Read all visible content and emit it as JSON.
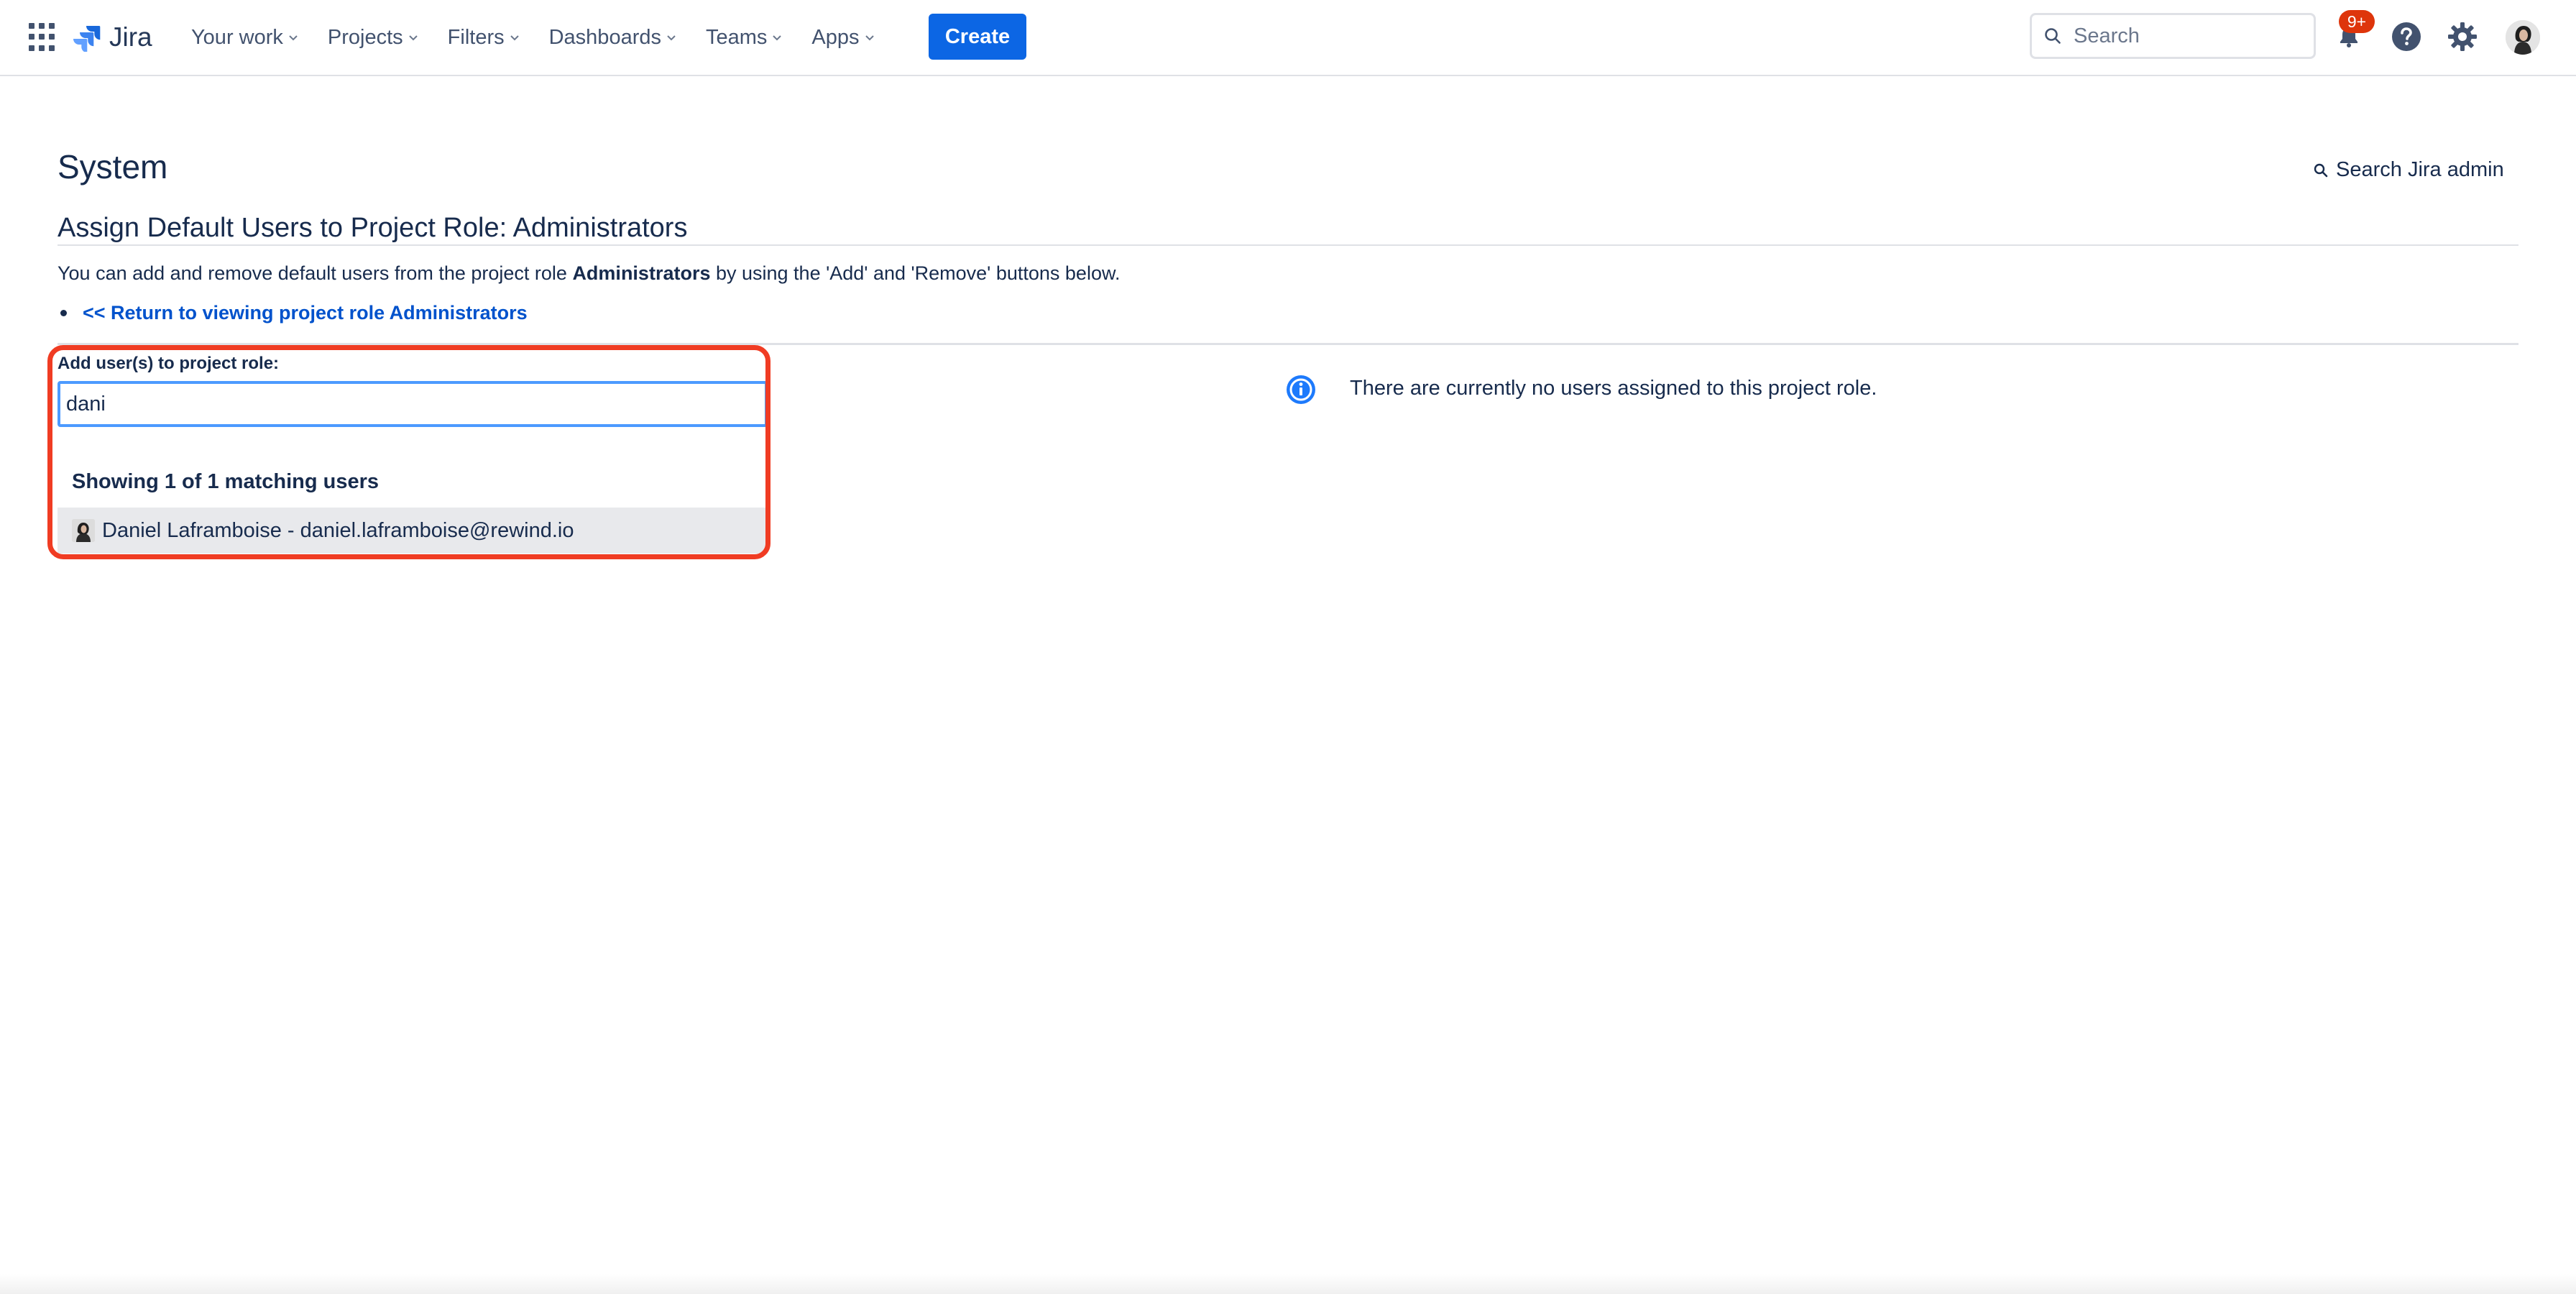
{
  "nav": {
    "logo_text": "Jira",
    "items": [
      {
        "label": "Your work"
      },
      {
        "label": "Projects"
      },
      {
        "label": "Filters"
      },
      {
        "label": "Dashboards"
      },
      {
        "label": "Teams"
      },
      {
        "label": "Apps"
      }
    ],
    "create_label": "Create",
    "search_placeholder": "Search",
    "notification_badge": "9+",
    "icons": [
      "app-switcher-icon",
      "jira-logo-icon",
      "search-icon",
      "notifications-icon",
      "help-icon",
      "settings-icon",
      "avatar"
    ]
  },
  "page": {
    "title": "System",
    "admin_search_label": "Search Jira admin",
    "section_title": "Assign Default Users to Project Role: Administrators",
    "description_pre": "You can add and remove default users from the project role ",
    "description_role": "Administrators",
    "description_post": " by using the 'Add' and 'Remove' buttons below.",
    "return_link": "<< Return to viewing project role Administrators"
  },
  "add_users": {
    "label": "Add user(s) to project role:",
    "input_value": "dani",
    "match_count_text": "Showing 1 of 1 matching users",
    "suggestions": [
      {
        "text": "Daniel Laframboise - daniel.laframboise@rewind.io"
      }
    ]
  },
  "assigned": {
    "empty_message": "There are currently no users assigned to this project role."
  },
  "colors": {
    "primary": "#0c66e4",
    "link": "#0052cc",
    "text": "#172b4d",
    "highlight": "#f03c23",
    "badge": "#de350b",
    "info": "#1d7afc"
  }
}
